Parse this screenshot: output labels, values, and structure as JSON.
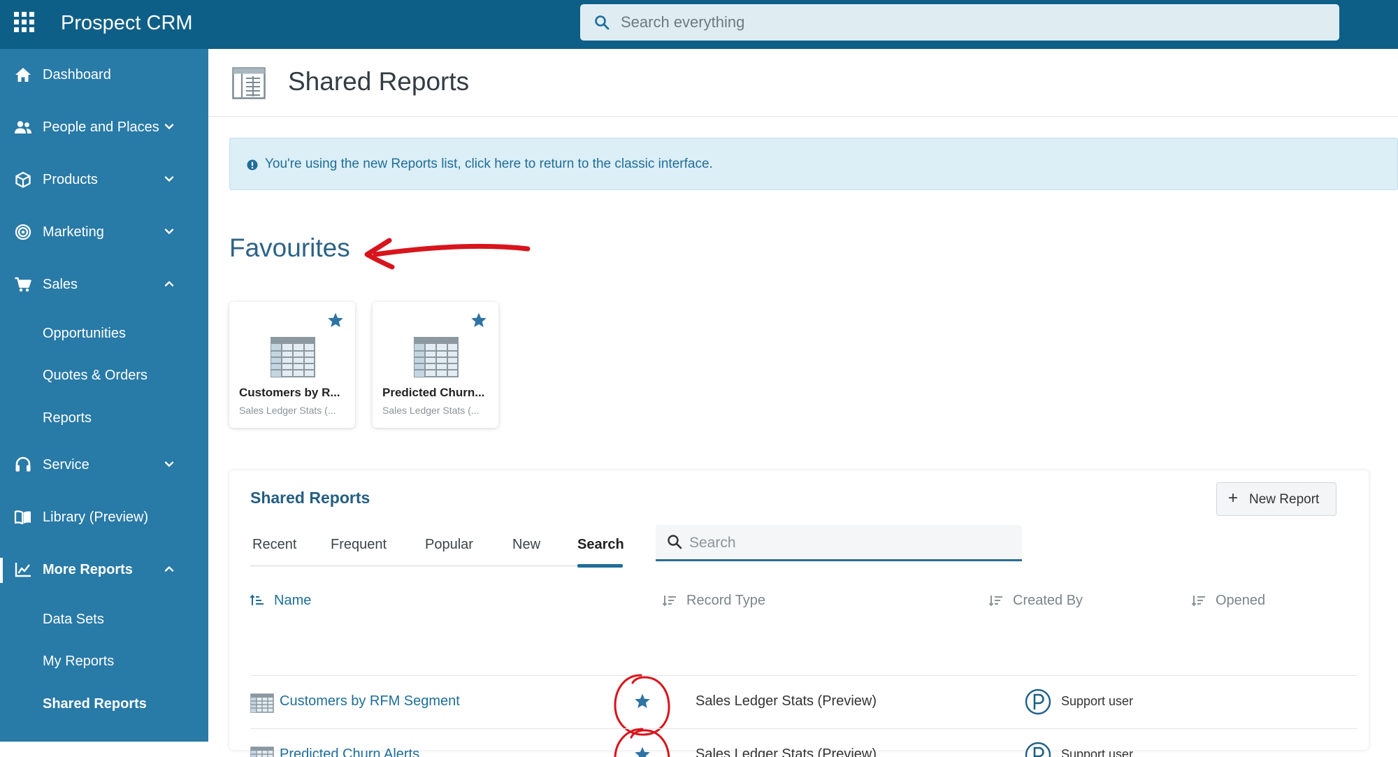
{
  "app": {
    "title": "Prospect CRM"
  },
  "global_search": {
    "placeholder": "Search everything"
  },
  "sidebar": {
    "items": [
      {
        "label": "Dashboard",
        "icon": "home-icon"
      },
      {
        "label": "People and Places",
        "icon": "people-icon"
      },
      {
        "label": "Products",
        "icon": "box-icon"
      },
      {
        "label": "Marketing",
        "icon": "target-icon"
      },
      {
        "label": "Sales",
        "icon": "cart-icon"
      },
      {
        "label": "Opportunities"
      },
      {
        "label": "Quotes & Orders"
      },
      {
        "label": "Reports"
      },
      {
        "label": "Service",
        "icon": "headset-icon"
      },
      {
        "label": "Library (Preview)",
        "icon": "book-icon"
      },
      {
        "label": "More Reports",
        "icon": "chart-icon"
      },
      {
        "label": "Data Sets"
      },
      {
        "label": "My Reports"
      },
      {
        "label": "Shared Reports"
      }
    ]
  },
  "header": {
    "title": "Shared Reports",
    "icon": "report-grid-icon"
  },
  "banner": {
    "text": "You're using the new Reports list, click here to return to the classic interface.",
    "icon": "info-icon"
  },
  "favourites": {
    "title": "Favourites",
    "cards": [
      {
        "title": "Customers by R...",
        "subtitle": "Sales Ledger Stats (..."
      },
      {
        "title": "Predicted Churn...",
        "subtitle": "Sales Ledger Stats (..."
      }
    ]
  },
  "reports": {
    "title": "Shared Reports",
    "new_button": "New Report",
    "tabs": [
      {
        "label": "Recent"
      },
      {
        "label": "Frequent"
      },
      {
        "label": "Popular"
      },
      {
        "label": "New"
      },
      {
        "label": "Search",
        "active": true
      }
    ],
    "search_placeholder": "Search",
    "columns": [
      "Name",
      "Record Type",
      "Created By",
      "Opened"
    ],
    "rows": [
      {
        "name": "Customers by RFM Segment",
        "record_type": "Sales Ledger Stats (Preview)",
        "created_by": "Support user",
        "favourite": true
      },
      {
        "name": "Predicted Churn Alerts",
        "record_type": "Sales Ledger Stats (Preview)",
        "created_by": "Support user",
        "favourite": true
      }
    ]
  },
  "colors": {
    "topbar": "#0e5f87",
    "sidebar": "#287aa7",
    "accent": "#1f6e98",
    "annotation": "#d8141c"
  }
}
